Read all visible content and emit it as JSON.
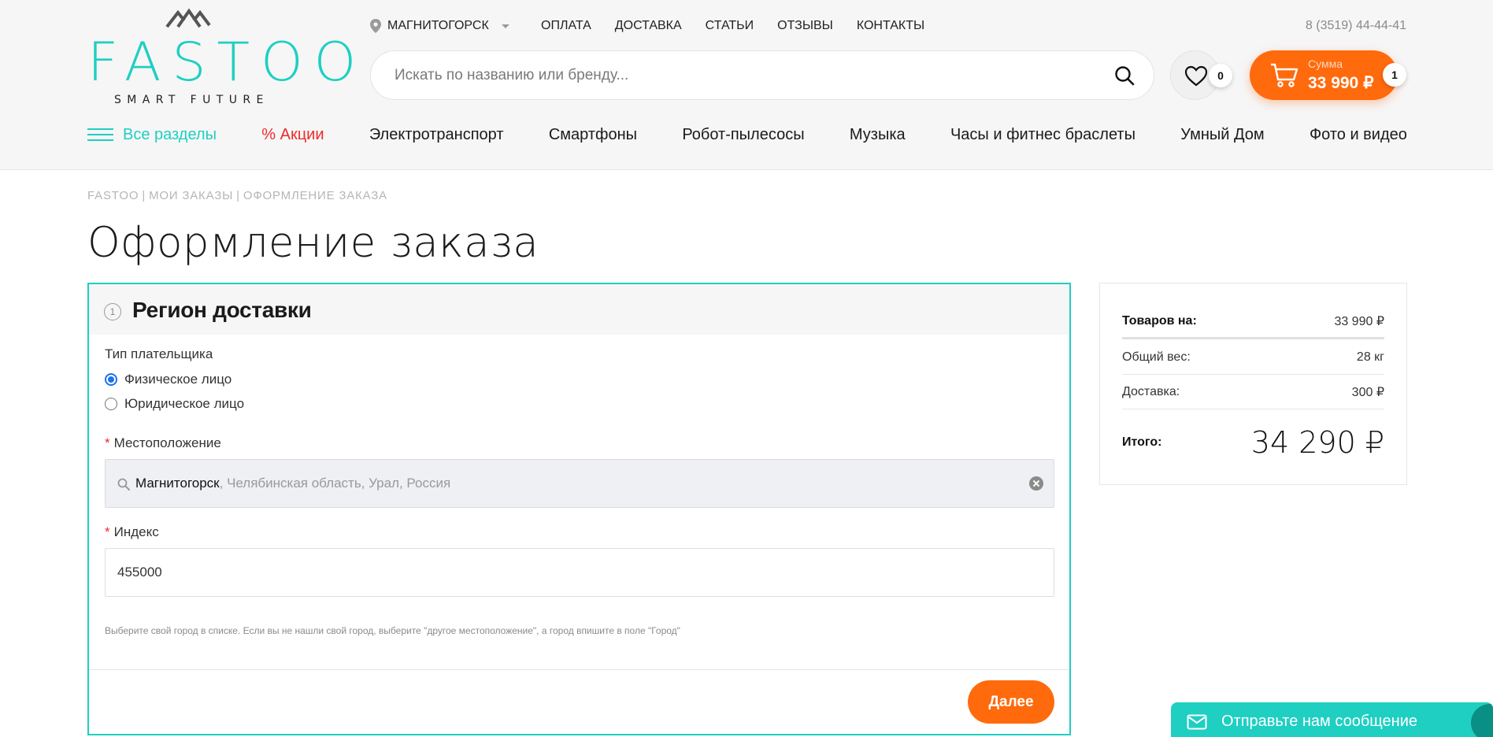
{
  "header": {
    "logo": {
      "brand": "FASTOO",
      "tagline": "SMART FUTURE"
    },
    "city": "МАГНИТОГОРСК",
    "top_nav": [
      "ОПЛАТА",
      "ДОСТАВКА",
      "СТАТЬИ",
      "ОТЗЫВЫ",
      "КОНТАКТЫ"
    ],
    "phone": "8 (3519) 44-44-41",
    "search_placeholder": "Искать по названию или бренду...",
    "favorites_count": "0",
    "cart": {
      "label": "Сумма",
      "value": "33 990 ₽",
      "count": "1"
    },
    "categories": {
      "all": "Все разделы",
      "sale": "% Акции",
      "items": [
        "Электротранспорт",
        "Смартфоны",
        "Робот-пылесосы",
        "Музыка",
        "Часы и фитнес браслеты",
        "Умный Дом",
        "Фото и видео"
      ]
    }
  },
  "breadcrumb": [
    "FASTOO",
    "МОИ ЗАКАЗЫ",
    "ОФОРМЛЕНИЕ ЗАКАЗА"
  ],
  "page_title": "Оформление заказа",
  "step": {
    "number": "1",
    "title": "Регион доставки",
    "payer_type_label": "Тип плательщика",
    "payer_options": [
      "Физическое лицо",
      "Юридическое лицо"
    ],
    "selected_payer": "Физическое лицо",
    "location_label": "Местоположение",
    "location_city": "Магнитогорск",
    "location_rest": ", Челябинская область, Урал, Россия",
    "index_label": "Индекс",
    "index_value": "455000",
    "hint": "Выберите свой город в списке. Если вы не нашли свой город, выберите \"другое местоположение\", а город впишите в поле \"Город\"",
    "next_button": "Далее"
  },
  "summary": {
    "goods_label": "Товаров на:",
    "goods_value": "33 990 ₽",
    "weight_label": "Общий вес:",
    "weight_value": "28 кг",
    "delivery_label": "Доставка:",
    "delivery_value": "300 ₽",
    "total_label": "Итого:",
    "total_value": "34 290 ₽"
  },
  "chat_widget": {
    "label": "Отправьте нам сообщение"
  },
  "colors": {
    "accent": "#1ecfc2",
    "orange": "#ff6a0d",
    "sale": "#ef2a2a"
  }
}
